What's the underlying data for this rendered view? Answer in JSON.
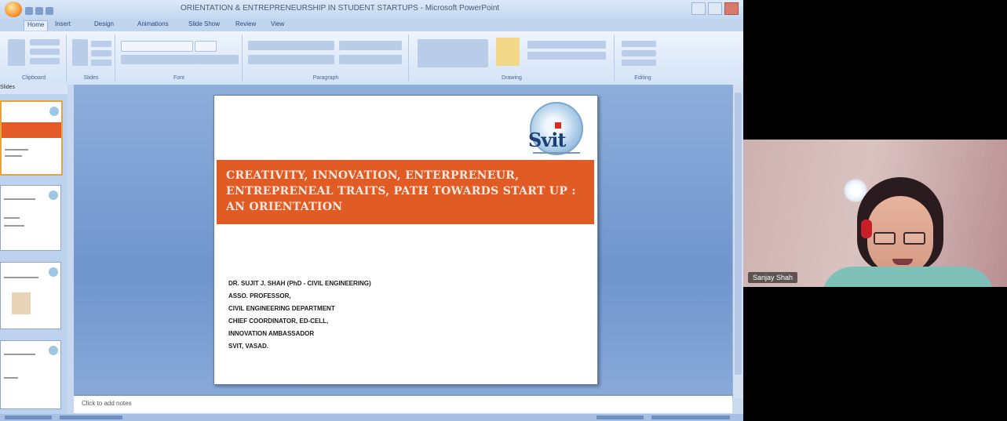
{
  "window": {
    "title": "ORIENTATION & ENTREPRENEURSHIP IN STUDENT STARTUPS - Microsoft PowerPoint",
    "app": "PowerPoint 2007"
  },
  "ribbon": {
    "tabs": [
      "Home",
      "Insert",
      "Design",
      "Animations",
      "Slide Show",
      "Review",
      "View"
    ],
    "groups": [
      "Clipboard",
      "Slides",
      "Font",
      "Paragraph",
      "Drawing",
      "Editing"
    ]
  },
  "slides_panel": {
    "tabs_label": "Slides"
  },
  "slide": {
    "logo_text": "Svit",
    "title": "CREATIVITY, INNOVATION, ENTERPRENEUR, ENTREPRENEAL TRAITS, PATH TOWARDS START UP : AN ORIENTATION",
    "body_lines": [
      "DR. SUJIT J. SHAH (PhD - CIVIL ENGINEERING)",
      "ASSO. PROFESSOR,",
      "CIVIL ENGINEERING DEPARTMENT",
      "CHIEF COORDINATOR, ED-CELL,",
      "INNOVATION AMBASSADOR",
      "SVIT, VASAD."
    ]
  },
  "notes": {
    "placeholder": "Click to add notes"
  },
  "video": {
    "participant_name": "Sanjay Shah"
  },
  "colors": {
    "title_band": "#e15b25",
    "ribbon_blue": "#d3e3f7",
    "edit_area": "#6f95cd"
  }
}
